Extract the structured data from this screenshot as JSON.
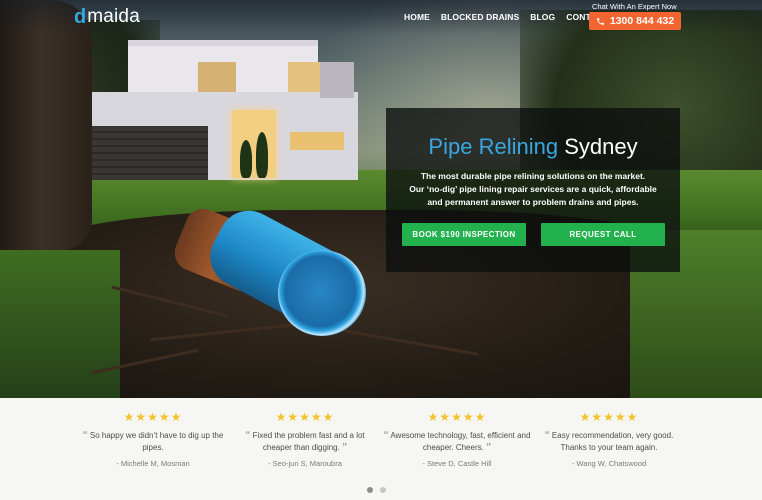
{
  "header": {
    "logo_mark": "d",
    "logo_text": "maida",
    "nav": [
      {
        "label": "HOME"
      },
      {
        "label": "BLOCKED DRAINS"
      },
      {
        "label": "BLOG"
      },
      {
        "label": "CONTACT"
      }
    ],
    "chat_label": "Chat With An Expert Now",
    "phone": "1300 844 432",
    "phone_icon": "phone-icon"
  },
  "hero": {
    "title_accent": "Pipe Relining",
    "title_rest": "Sydney",
    "body_line1": "The most durable pipe relining solutions on the market.",
    "body_line2": "Our ‘no-dig’ pipe lining repair services are a quick, affordable",
    "body_line3": "and permanent answer to problem drains and pipes.",
    "btn_book": "BOOK $190 INSPECTION",
    "btn_call": "REQUEST CALL"
  },
  "testimonials": {
    "reviews": [
      {
        "stars": "★★★★★",
        "open_quote": "“",
        "text": "So happy we didn’t have to dig up the pipes.",
        "close_quote": "”",
        "author": "- Michelle M, Mosman"
      },
      {
        "stars": "★★★★★",
        "open_quote": "“",
        "text": "Fixed the problem fast and a lot cheaper than digging.",
        "close_quote": "”",
        "author": "- Seo-jun S, Maroubra"
      },
      {
        "stars": "★★★★★",
        "open_quote": "“",
        "text": "Awesome technology, fast, efficient and cheaper. Cheers.",
        "close_quote": "”",
        "author": "- Steve D, Castle Hill"
      },
      {
        "stars": "★★★★★",
        "open_quote": "“",
        "text": "Easy recommendation, very good. Thanks to your team again.",
        "close_quote": "”",
        "author": "- Wang W, Chatswood"
      }
    ],
    "active_slide": 1,
    "slide_count": 2
  },
  "colors": {
    "accent_blue": "#3aa6e1",
    "phone_orange": "#f26430",
    "cta_green": "#23b14d",
    "star_yellow": "#f4c22b"
  }
}
